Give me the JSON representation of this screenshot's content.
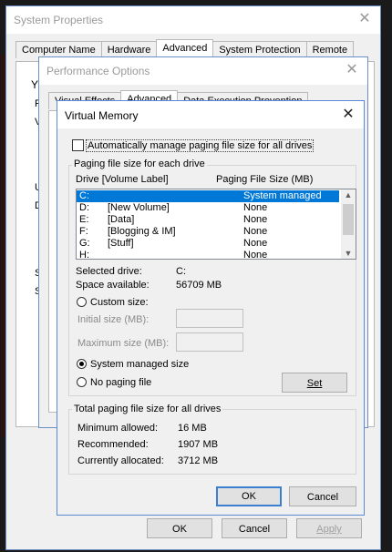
{
  "system_properties": {
    "title": "System Properties",
    "tabs": [
      "Computer Name",
      "Hardware",
      "Advanced",
      "System Protection",
      "Remote"
    ],
    "side_letters": [
      "Y",
      "P",
      "V",
      "U",
      "D",
      "S",
      "S"
    ],
    "buttons": {
      "ok": "OK",
      "cancel": "Cancel",
      "apply": "Apply"
    }
  },
  "performance_options": {
    "title": "Performance Options",
    "tabs": [
      "Visual Effects",
      "Advanced",
      "Data Execution Prevention"
    ]
  },
  "virtual_memory": {
    "title": "Virtual Memory",
    "auto_manage_label": "Automatically manage paging file size for all drives",
    "auto_manage_checked": false,
    "group_per_drive": "Paging file size for each drive",
    "col_drive": "Drive  [Volume Label]",
    "col_size": "Paging File Size (MB)",
    "drives": [
      {
        "drive": "C:",
        "label": "",
        "size": "System managed",
        "selected": true
      },
      {
        "drive": "D:",
        "label": "[New Volume]",
        "size": "None"
      },
      {
        "drive": "E:",
        "label": "[Data]",
        "size": "None"
      },
      {
        "drive": "F:",
        "label": "[Blogging & IM]",
        "size": "None"
      },
      {
        "drive": "G:",
        "label": "[Stuff]",
        "size": "None"
      },
      {
        "drive": "H:",
        "label": "",
        "size": "None"
      }
    ],
    "selected_drive_label": "Selected drive:",
    "selected_drive_value": "C:",
    "space_available_label": "Space available:",
    "space_available_value": "56709 MB",
    "custom_size": "Custom size:",
    "initial_size": "Initial size (MB):",
    "maximum_size": "Maximum size (MB):",
    "system_managed": "System managed size",
    "no_paging": "No paging file",
    "set_button": "Set",
    "selected_option": "system_managed",
    "group_total": "Total paging file size for all drives",
    "minimum_allowed_label": "Minimum allowed:",
    "minimum_allowed_value": "16 MB",
    "recommended_label": "Recommended:",
    "recommended_value": "1907 MB",
    "currently_allocated_label": "Currently allocated:",
    "currently_allocated_value": "3712 MB",
    "ok": "OK",
    "cancel": "Cancel"
  }
}
